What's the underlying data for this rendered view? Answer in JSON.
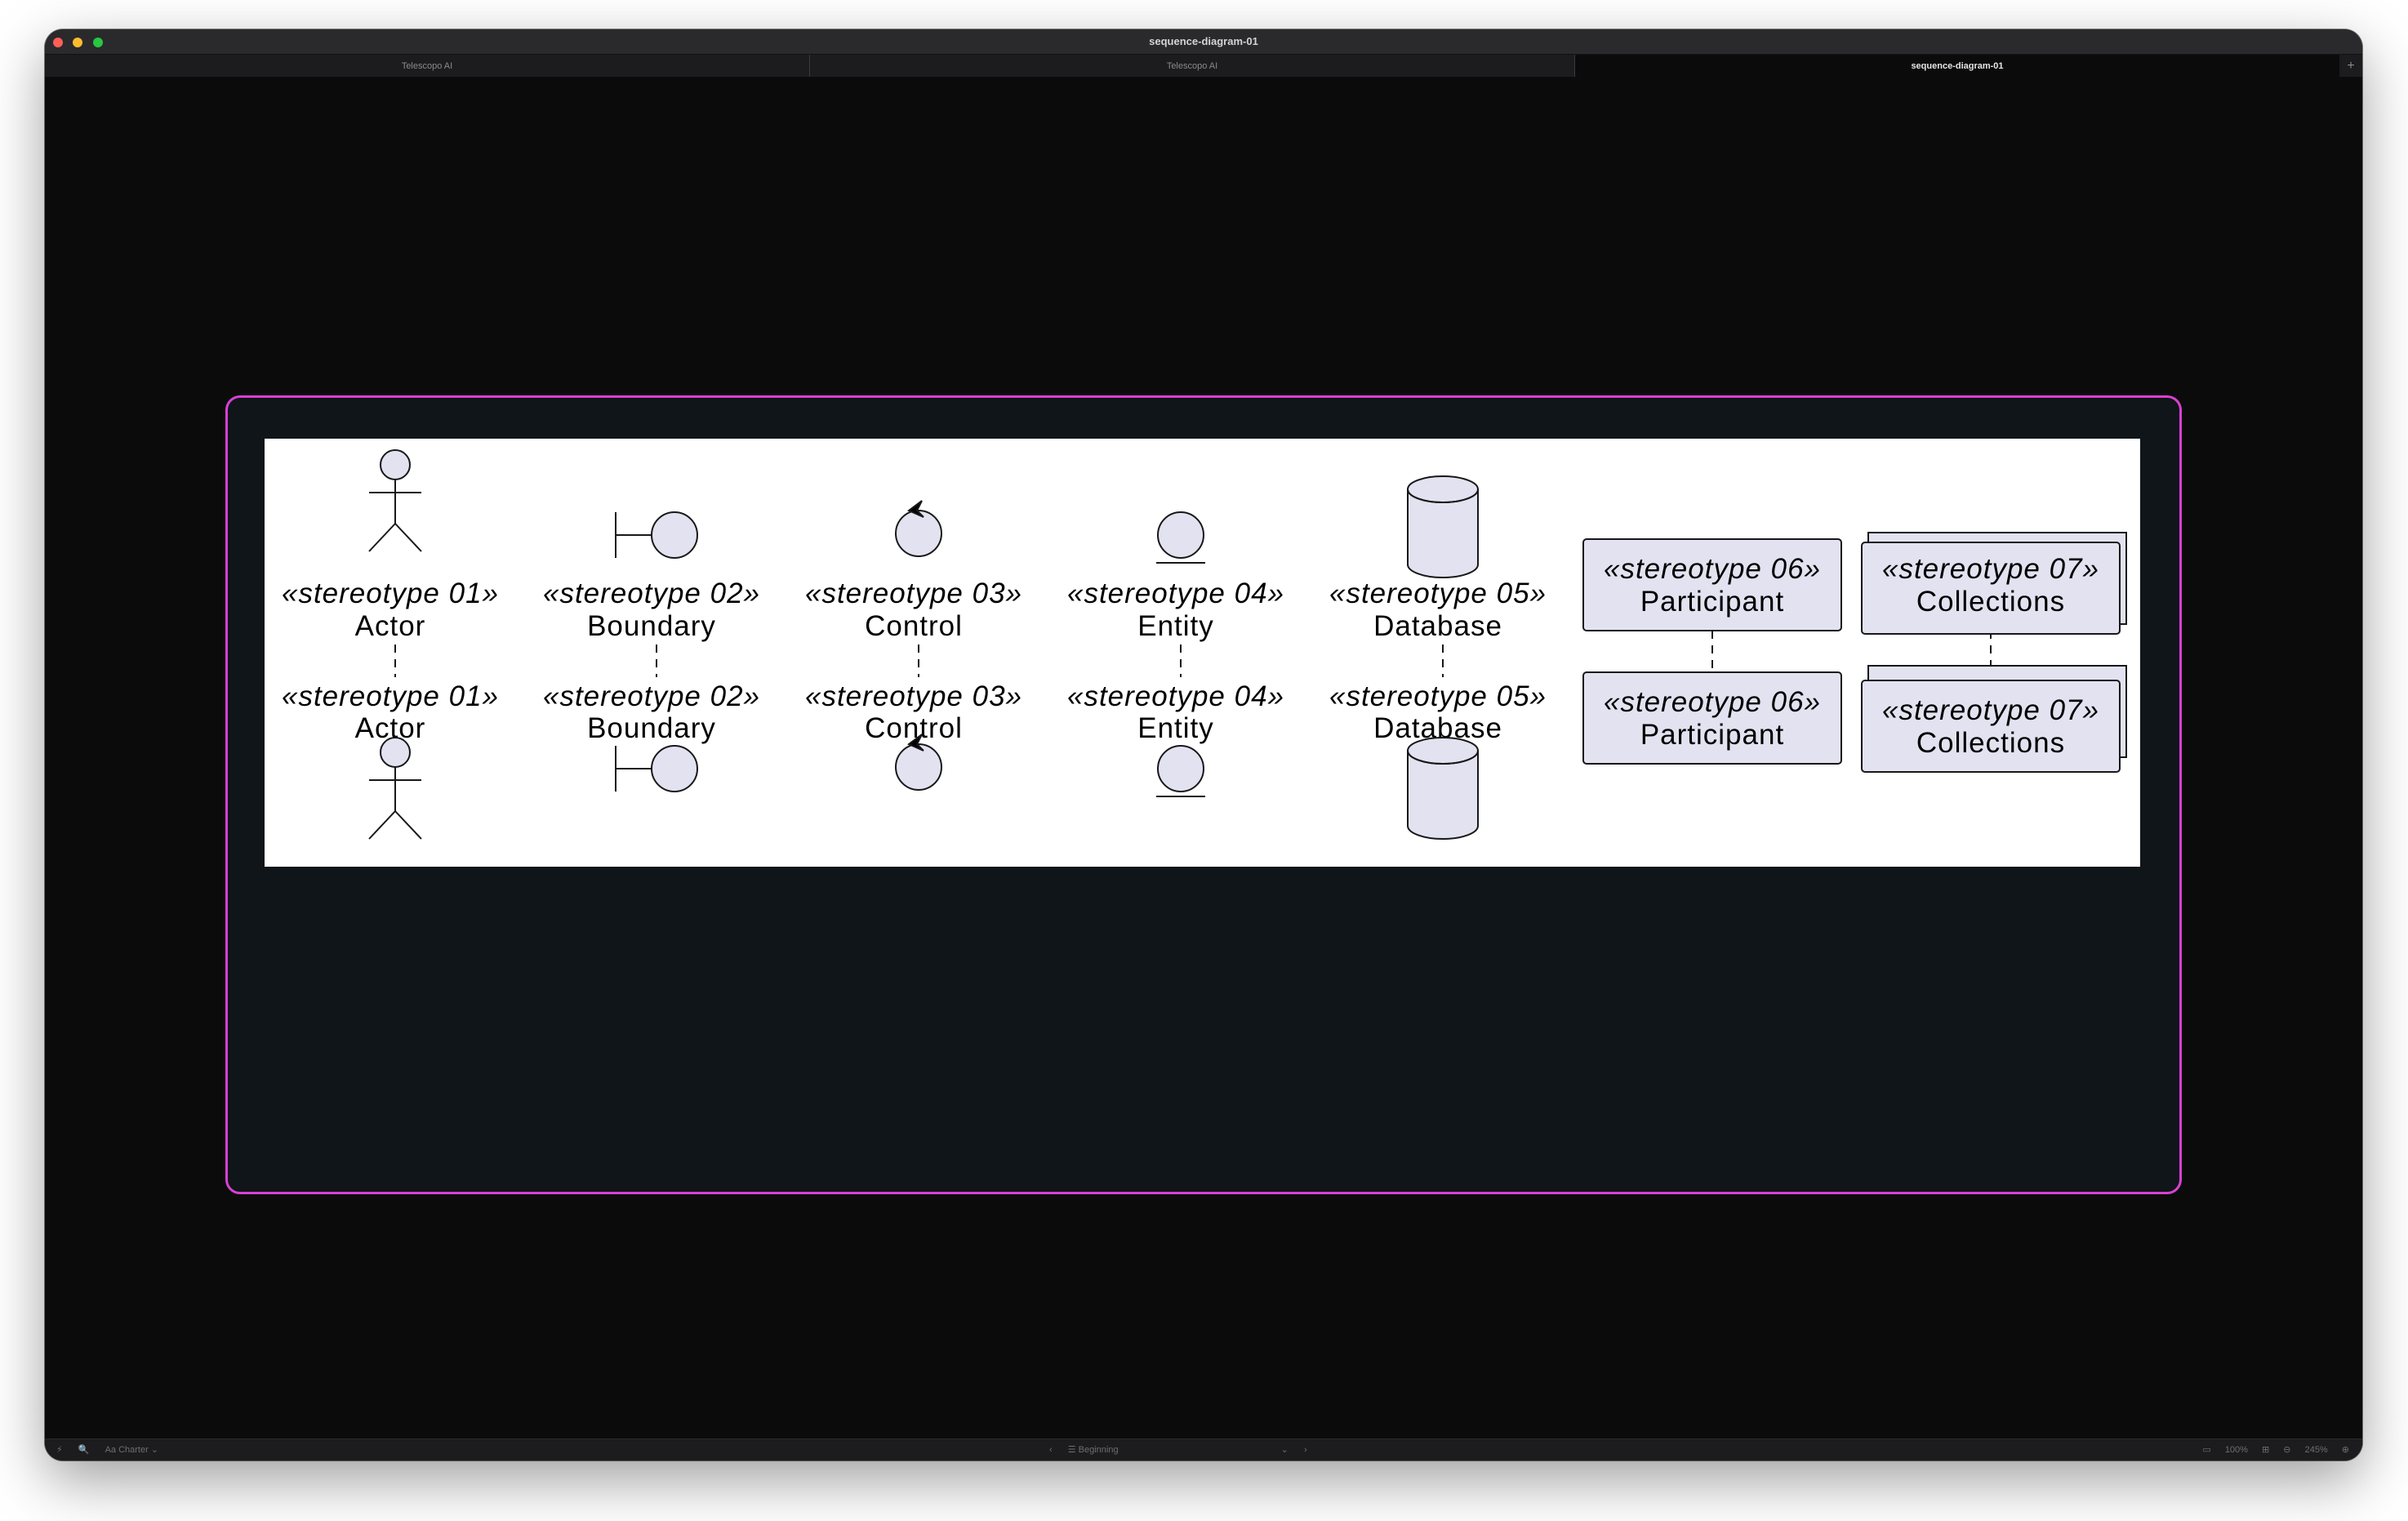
{
  "window": {
    "title": "sequence-diagram-01"
  },
  "tabs": [
    {
      "label": "Telescopo AI",
      "active": false
    },
    {
      "label": "Telescopo AI",
      "active": false
    },
    {
      "label": "sequence-diagram-01",
      "active": true
    }
  ],
  "tab_add_label": "+",
  "diagram": {
    "participants": [
      {
        "kind": "actor",
        "stereotype": "«stereotype 01»",
        "name": "Actor"
      },
      {
        "kind": "boundary",
        "stereotype": "«stereotype 02»",
        "name": "Boundary"
      },
      {
        "kind": "control",
        "stereotype": "«stereotype 03»",
        "name": "Control"
      },
      {
        "kind": "entity",
        "stereotype": "«stereotype 04»",
        "name": "Entity"
      },
      {
        "kind": "database",
        "stereotype": "«stereotype 05»",
        "name": "Database"
      },
      {
        "kind": "participant",
        "stereotype": "«stereotype 06»",
        "name": "Participant"
      },
      {
        "kind": "collections",
        "stereotype": "«stereotype 07»",
        "name": "Collections"
      }
    ],
    "colors": {
      "background": "#ffffff",
      "shape_fill": "#e2e2f0",
      "stroke": "#181818",
      "frame_border": "#d940d3",
      "frame_fill": "#0f1518"
    }
  },
  "statusbar": {
    "left": [
      "⚡",
      "🔍",
      "Aa Charter ⌄"
    ],
    "center_prev": "‹",
    "center_label": "☰ Beginning",
    "center_dropdown": "⌄",
    "center_next": "›",
    "zoom_fit_label": "100%",
    "zoom_label": "245%"
  }
}
